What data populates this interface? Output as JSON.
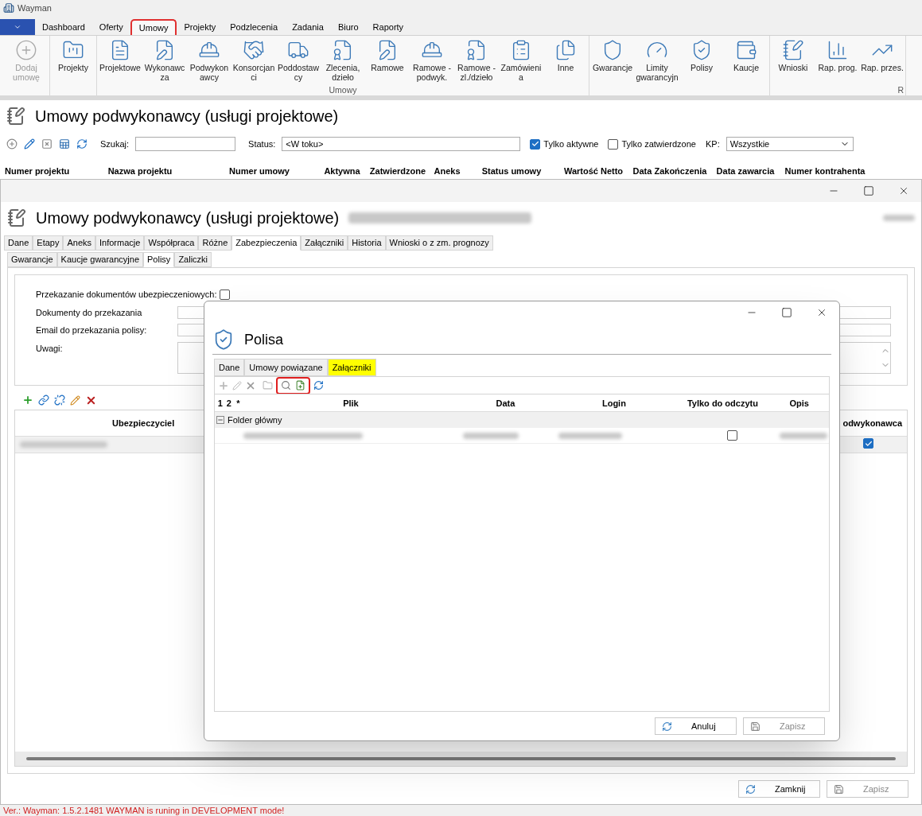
{
  "app": {
    "title": "Wayman"
  },
  "ribbon": {
    "tabs": [
      {
        "label": "Dashboard",
        "selected": false
      },
      {
        "label": "Oferty",
        "selected": false
      },
      {
        "label": "Umowy",
        "selected": true
      },
      {
        "label": "Projekty",
        "selected": false
      },
      {
        "label": "Podzlecenia",
        "selected": false
      },
      {
        "label": "Zadania",
        "selected": false
      },
      {
        "label": "Biuro",
        "selected": false
      },
      {
        "label": "Raporty",
        "selected": false
      }
    ],
    "groups": [
      {
        "buttons": [
          {
            "label": "Dodaj umowę",
            "disabled": true
          }
        ]
      },
      {
        "buttons": [
          {
            "label": "Projekty",
            "disabled": false
          }
        ]
      },
      {
        "label": "Umowy",
        "buttons": [
          {
            "label": "Projektowe",
            "disabled": false
          },
          {
            "label": "Wykonawcza",
            "disabled": false
          },
          {
            "label": "Podwykonawcy",
            "disabled": false
          },
          {
            "label": "Konsorcjanci",
            "disabled": false
          },
          {
            "label": "Poddostawcy",
            "disabled": false
          },
          {
            "label": "Zlecenia, dzieło",
            "disabled": false
          },
          {
            "label": "Ramowe",
            "disabled": false
          },
          {
            "label": "Ramowe - podwyk.",
            "disabled": false
          },
          {
            "label": "Ramowe - zl./dzieło",
            "disabled": false
          },
          {
            "label": "Zamówienia",
            "disabled": false
          },
          {
            "label": "Inne",
            "disabled": false
          }
        ]
      },
      {
        "buttons": [
          {
            "label": "Gwarancje",
            "disabled": false
          },
          {
            "label": "Limity gwarancyjn",
            "disabled": false
          },
          {
            "label": "Polisy",
            "disabled": false
          },
          {
            "label": "Kaucje",
            "disabled": false
          }
        ]
      },
      {
        "label": "R",
        "buttons": [
          {
            "label": "Wnioski",
            "disabled": false
          },
          {
            "label": "Rap. prog.",
            "disabled": false
          },
          {
            "label": "Rap. przes.",
            "disabled": false
          }
        ]
      }
    ]
  },
  "list_window": {
    "title": "Umowy podwykonawcy (usługi projektowe)",
    "search": {
      "label": "Szukaj:"
    },
    "status": {
      "label": "Status:",
      "value": "<W toku>"
    },
    "filters": [
      {
        "label": "Tylko aktywne",
        "checked": true
      },
      {
        "label": "Tylko zatwierdzone",
        "checked": false
      }
    ],
    "kp": {
      "label": "KP:",
      "value": "Wszystkie"
    },
    "columns": [
      "Numer projektu",
      "Nazwa projektu",
      "Numer umowy",
      "Aktywna",
      "Zatwierdzone",
      "Aneks",
      "Status umowy",
      "Wartość Netto",
      "Data Zakończenia",
      "Data zawarcia",
      "Numer kontrahenta"
    ]
  },
  "detail_window": {
    "title": "Umowy podwykonawcy (usługi projektowe)",
    "tabs": [
      {
        "label": "Dane",
        "selected": false
      },
      {
        "label": "Etapy",
        "selected": false
      },
      {
        "label": "Aneks",
        "selected": false
      },
      {
        "label": "Informacje",
        "selected": false
      },
      {
        "label": "Współpraca",
        "selected": false
      },
      {
        "label": "Różne",
        "selected": false
      },
      {
        "label": "Zabezpieczenia",
        "selected": true
      },
      {
        "label": "Załączniki",
        "selected": false
      },
      {
        "label": "Historia",
        "selected": false
      },
      {
        "label": "Wnioski o z zm. prognozy",
        "selected": false
      }
    ],
    "subtabs": [
      {
        "label": "Gwarancje",
        "selected": false
      },
      {
        "label": "Kaucje gwarancyjne",
        "selected": false
      },
      {
        "label": "Polisy",
        "selected": true
      },
      {
        "label": "Zaliczki",
        "selected": false
      }
    ],
    "form": {
      "transfer": {
        "label": "Przekazanie dokumentów ubezpieczeniowych:",
        "checked": false
      },
      "documents": {
        "label": "Dokumenty do przekazania"
      },
      "email": {
        "label": "Email do przekazania polisy:"
      },
      "notes": {
        "label": "Uwagi:"
      }
    },
    "grid": {
      "columns": [
        "Ubezpieczyciel",
        "odwykonawca"
      ],
      "rows": [
        {
          "checked": true
        }
      ]
    },
    "buttons": [
      {
        "label": "Zamknij",
        "disabled": false
      },
      {
        "label": "Zapisz",
        "disabled": true
      }
    ]
  },
  "dialog": {
    "title": "Polisa",
    "tabs": [
      {
        "label": "Dane",
        "selected": false
      },
      {
        "label": "Umowy powiązane",
        "selected": false
      },
      {
        "label": "Załączniki",
        "selected": true
      }
    ],
    "columns": [
      "1",
      "2",
      "*",
      "Plik",
      "Data",
      "Login",
      "Tylko do odczytu",
      "Opis"
    ],
    "group": "Folder główny",
    "rows": [
      {
        "read_only": false
      }
    ],
    "buttons": [
      {
        "label": "Anuluj",
        "disabled": false
      },
      {
        "label": "Zapisz",
        "disabled": true
      }
    ]
  },
  "status_bar": "Ver.: Wayman: 1.5.2.1481 WAYMAN is runing in DEVELOPMENT mode!"
}
